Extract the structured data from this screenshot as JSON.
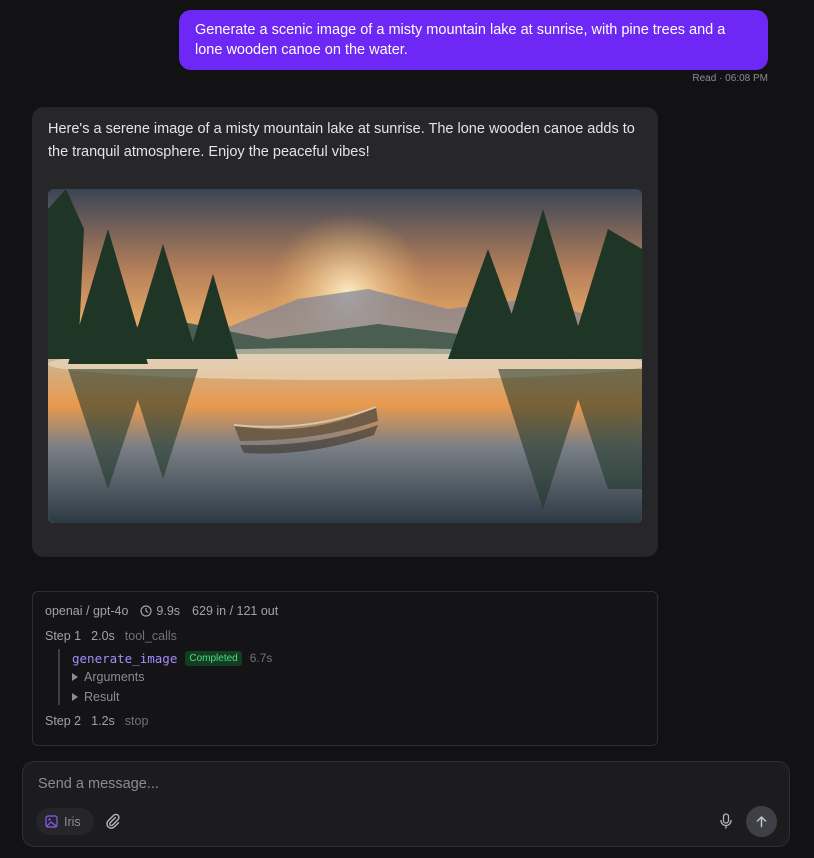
{
  "user_message": {
    "text": "Generate a scenic image of a misty mountain lake at sunrise, with pine trees and a lone wooden canoe on the water.",
    "status": "Read · 06:08 PM"
  },
  "assistant_message": {
    "text": "Here's a serene image of a misty mountain lake at sunrise. The lone wooden canoe adds to the tranquil atmosphere. Enjoy the peaceful vibes!"
  },
  "trace": {
    "model": "openai / gpt-4o",
    "duration": "9.9s",
    "tokens": "629 in / 121 out",
    "steps": [
      {
        "label": "Step 1",
        "time": "2.0s",
        "kind": "tool_calls"
      },
      {
        "label": "Step 2",
        "time": "1.2s",
        "kind": "stop"
      }
    ],
    "tool": {
      "name": "generate_image",
      "status": "Completed",
      "time": "6.7s",
      "arguments_label": "Arguments",
      "result_label": "Result"
    }
  },
  "composer": {
    "placeholder": "Send a message...",
    "persona": "Iris"
  },
  "colors": {
    "accent": "#6d28f5",
    "success": "#4ade80",
    "tool_name": "#a78bfa"
  },
  "icons": [
    "clock-icon",
    "image-icon",
    "paperclip-icon",
    "microphone-icon",
    "arrow-up-icon"
  ]
}
